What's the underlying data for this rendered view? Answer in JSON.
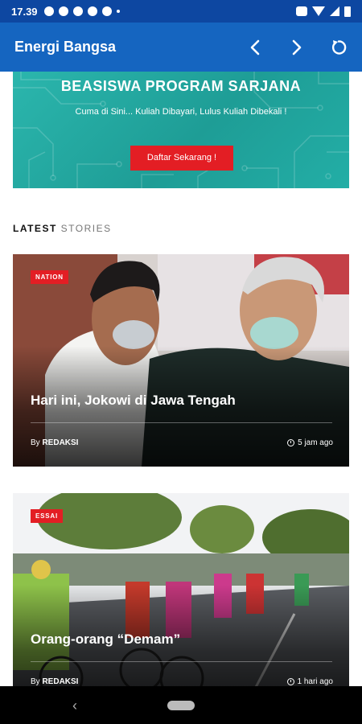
{
  "status_bar": {
    "time": "17.39"
  },
  "app_bar": {
    "title": "Energi Bangsa",
    "actions": [
      "chevron-left-icon",
      "chevron-right-icon",
      "refresh-icon"
    ]
  },
  "banner": {
    "title": "BEASISWA PROGRAM SARJANA",
    "subtitle": "Cuma di Sini... Kuliah Dibayari, Lulus Kuliah Dibekali !",
    "button": "Daftar Sekarang !"
  },
  "section": {
    "strong": "LATEST",
    "light": "STORIES"
  },
  "stories": [
    {
      "category": "NATION",
      "title": "Hari ini, Jokowi di Jawa Tengah",
      "by_prefix": "By",
      "author": "REDAKSI",
      "time": "5 jam ago"
    },
    {
      "category": "ESSAI",
      "title": "Orang-orang “Demam”",
      "by_prefix": "By",
      "author": "REDAKSI",
      "time": "1 hari ago"
    }
  ],
  "colors": {
    "primary": "#1565c0",
    "status": "#0d47a1",
    "accent": "#e31e24",
    "banner": "#23aea6"
  }
}
